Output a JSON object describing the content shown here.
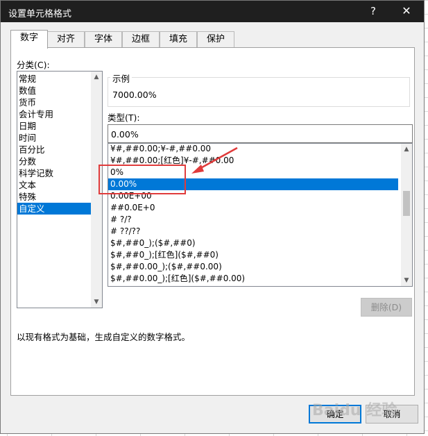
{
  "window": {
    "title": "设置单元格格式",
    "help_label": "?",
    "close_label": "✕"
  },
  "tabs": [
    "数字",
    "对齐",
    "字体",
    "边框",
    "填充",
    "保护"
  ],
  "category": {
    "label": "分类(C):",
    "items": [
      "常规",
      "数值",
      "货币",
      "会计专用",
      "日期",
      "时间",
      "百分比",
      "分数",
      "科学记数",
      "文本",
      "特殊",
      "自定义"
    ],
    "selected_index": 11
  },
  "sample": {
    "label": "示例",
    "value": "7000.00%"
  },
  "type": {
    "label": "类型(T):",
    "value": "0.00%",
    "items": [
      "¥#,##0.00;¥-#,##0.00",
      "¥#,##0.00;[红色]¥-#,##0.00",
      "0%",
      "0.00%",
      "0.00E+00",
      "##0.0E+0",
      "# ?/?",
      "# ??/??",
      "$#,##0_);($#,##0)",
      "$#,##0_);[红色]($#,##0)",
      "$#,##0.00_);($#,##0.00)",
      "$#,##0.00_);[红色]($#,##0.00)"
    ],
    "selected_index": 3
  },
  "delete_button": "删除(D)",
  "description": "以现有格式为基础，生成自定义的数字格式。",
  "ok_button": "确定",
  "cancel_button": "取消",
  "watermark": "Baidu 经验",
  "colors": {
    "selection": "#0078d7",
    "annotation": "#e03b3b",
    "titlebar": "#1f1f1f"
  }
}
